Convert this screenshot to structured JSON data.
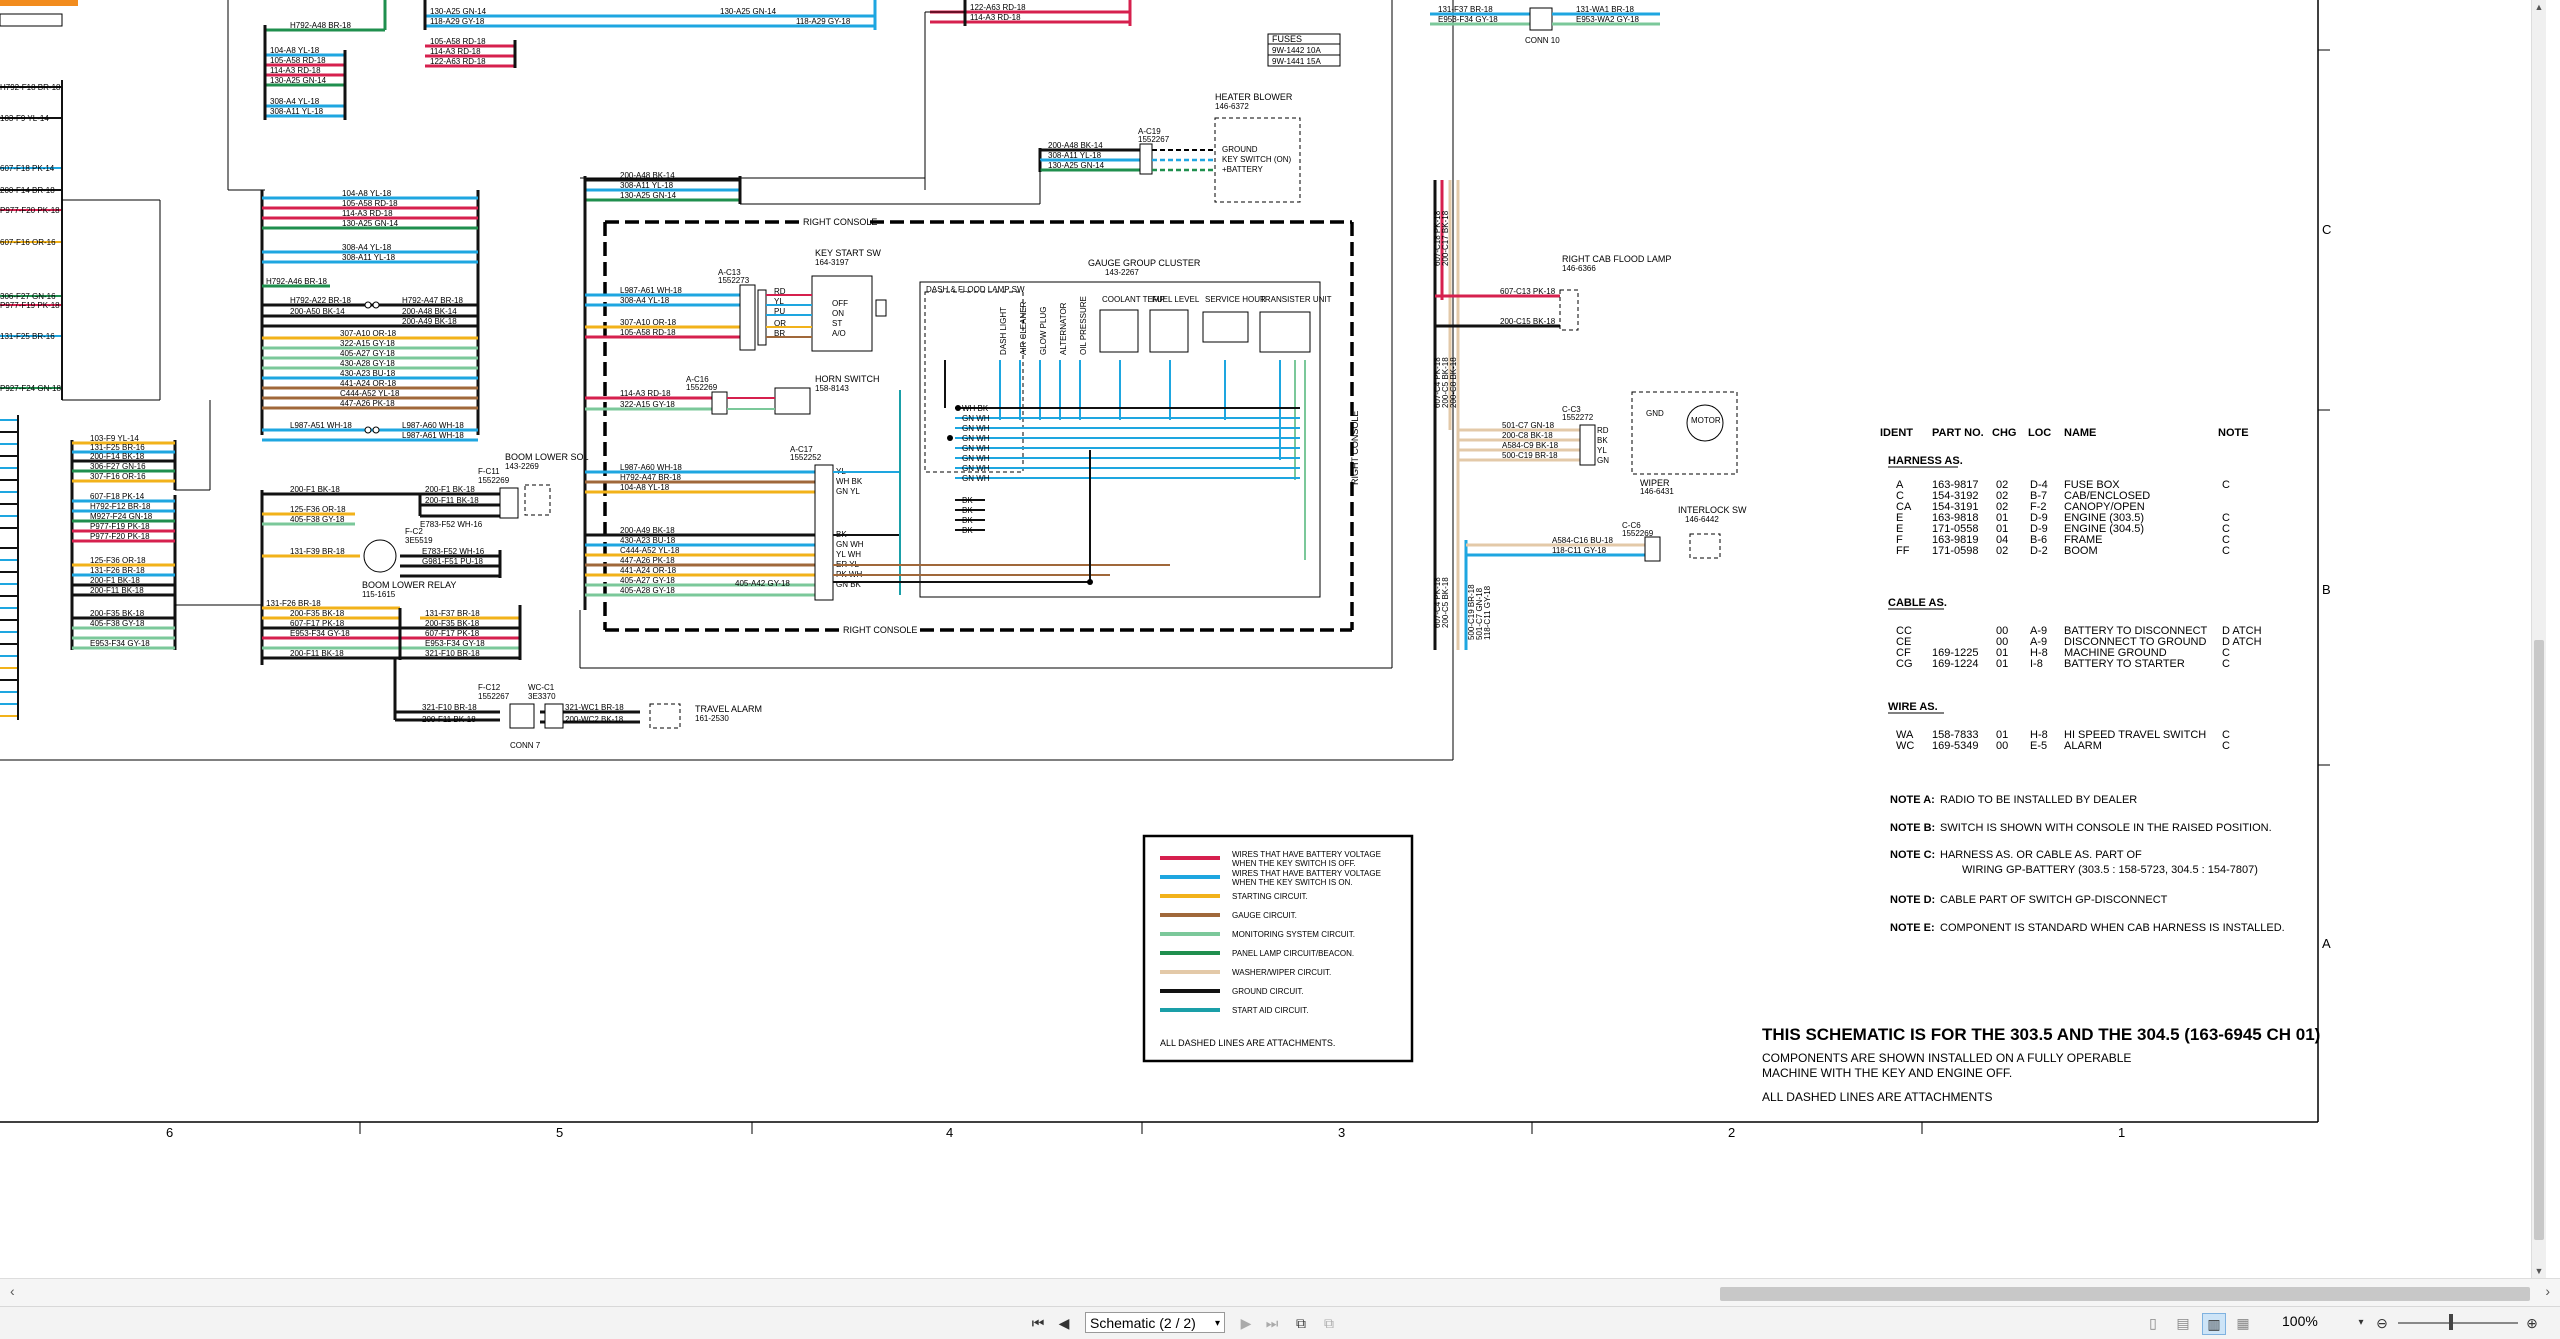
{
  "document": {
    "title": "THIS SCHEMATIC IS FOR THE 303.5 AND THE 304.5 (163-6945 CH 01)",
    "subtitle_lines": [
      "COMPONENTS ARE SHOWN INSTALLED ON A FULLY OPERABLE",
      "MACHINE WITH THE KEY AND ENGINE OFF.",
      "ALL DASHED LINES ARE ATTACHMENTS"
    ],
    "zones_bottom": [
      "6",
      "5",
      "4",
      "3",
      "2",
      "1"
    ],
    "zones_right": [
      "C",
      "B",
      "A"
    ]
  },
  "components": {
    "fuses": {
      "title": "FUSES",
      "rows": [
        "9W-1442  10A",
        "9W-1441  15A"
      ]
    },
    "heater_blower": {
      "name": "HEATER BLOWER",
      "part": "146-6372",
      "connector": "A-C19",
      "connector_part": "1552267",
      "pins": [
        "GROUND",
        "KEY SWITCH (ON)",
        "+BATTERY"
      ]
    },
    "right_console_top": "RIGHT CONSOLE",
    "right_console_bottom": "RIGHT CONSOLE",
    "right_console_side": "RIGHT CONSOLE",
    "key_start_sw": {
      "name": "KEY START SW",
      "part": "164-3197",
      "connector": "A-C13",
      "connector_part": "1552273",
      "pins": [
        "RD",
        "YL",
        "PU",
        "OR",
        "BR"
      ],
      "positions": [
        "OFF",
        "ON",
        "ST",
        "A/O"
      ]
    },
    "horn_switch": {
      "name": "HORN SWITCH",
      "part": "158-8143",
      "connector": "A-C16",
      "connector_part": "1552269"
    },
    "gauge_cluster": {
      "name": "GAUGE GROUP CLUSTER",
      "part": "143-2267",
      "connector": "A-C17",
      "connector_part": "1552252",
      "sections": [
        "DASH & FLOOD LAMP SW",
        "COOLANT TEMP",
        "FUEL LEVEL",
        "SERVICE HOUR",
        "TRANSISTER UNIT"
      ],
      "indicators": [
        "DASH LIGHT",
        "AIR CLEANER",
        "GLOW PLUG",
        "ALTERNATOR",
        "OIL PRESSURE"
      ]
    },
    "right_cab_flood_lamp": {
      "name": "RIGHT CAB FLOOD LAMP",
      "part": "146-6366"
    },
    "wiper": {
      "name": "WIPER",
      "part": "146-6431",
      "connector": "C-C3",
      "connector_part": "1552272",
      "pins": [
        "RD",
        "BK",
        "YL",
        "GN"
      ],
      "labels": [
        "GND",
        "MOTOR"
      ]
    },
    "interlock_sw": {
      "name": "INTERLOCK SW",
      "part": "146-6442",
      "connector": "C-C6",
      "connector_part": "1552269"
    },
    "boom_lower_sol": {
      "name": "BOOM LOWER SOL",
      "part": "143-2269",
      "connector": "F-C11",
      "connector_part": "1552269"
    },
    "boom_lower_relay": {
      "name": "BOOM LOWER RELAY",
      "part": "115-1615",
      "connector": "F-C2",
      "connector_part": "3E5519"
    },
    "travel_alarm": {
      "name": "TRAVEL ALARM",
      "part": "161-2530",
      "connector": "WC-C1",
      "connector_part": "3E3370",
      "connector2": "F-C12",
      "connector2_part": "1552267"
    },
    "conn7": "CONN 7",
    "conn10": "CONN 10"
  },
  "wire_labels": {
    "top_left": [
      "H792-A48  BR-18",
      "104-A8  YL-18",
      "105-A58  RD-18",
      "114-A3  RD-18",
      "130-A25  GN-14",
      "308-A4  YL-18",
      "308-A11  YL-18"
    ],
    "top_mid": [
      "130-A25  GN-14",
      "118-A29  GY-18",
      "105-A58  RD-18",
      "114-A3  RD-18",
      "122-A63  RD-18",
      "122-A63  RD-18",
      "114-A3  RD-18",
      "118-A29  GY-18"
    ],
    "bundle_mid": [
      "104-A8  YL-18",
      "105-A58  RD-18",
      "114-A3  RD-18",
      "130-A25  GN-14",
      "308-A4  YL-18",
      "308-A11  YL-18",
      "H792-A46  BR-18",
      "H792-A22  BR-18",
      "200-A50  BK-14",
      "307-A10  OR-18",
      "322-A15  GY-18",
      "405-A27  GY-18",
      "430-A28  GY-18",
      "430-A23  BU-18",
      "441-A24  OR-18",
      "C444-A52  YL-18",
      "447-A26  PK-18",
      "L987-A51  WH-18",
      "H792-A47  BR-18",
      "200-A48  BK-14",
      "200-A49  BK-18",
      "L987-A60  WH-18",
      "L987-A61  WH-18"
    ],
    "heater": [
      "200-A48  BK-14",
      "308-A11  YL-18",
      "130-A25  GN-14"
    ],
    "console_in": [
      "200-A48  BK-14",
      "308-A11  YL-18",
      "130-A25  GN-14",
      "L987-A61  WH-18",
      "308-A4  YL-18",
      "307-A10  OR-18",
      "105-A58  RD-18",
      "114-A3  RD-18",
      "322-A15  GY-18",
      "L987-A60  WH-18",
      "H792-A47  BR-18",
      "104-A8  YL-18",
      "200-A49  BK-18",
      "430-A23  BU-18",
      "C444-A52  YL-18",
      "447-A26  PK-18",
      "441-A24  OR-18",
      "405-A27  GY-18",
      "405-A28  GY-18",
      "405-A42  GY-18"
    ],
    "cluster_pins": [
      "YL",
      "WH BK",
      "GN YL",
      "BK",
      "GN WH",
      "YL WH",
      "ER YL",
      "PK WH",
      "GN BK"
    ],
    "cluster_inner": [
      "WH BK",
      "GN WH",
      "GN WH",
      "GN WH",
      "GN WH",
      "GN WH",
      "GN WH",
      "GN WH",
      "BK",
      "BK",
      "BK",
      "BK"
    ],
    "left_col": [
      "H792-F18  BR-18",
      "103-F9  YL-14",
      "607-F18  PK-14",
      "200-F14  BR-18",
      "P977-F20  PK-18",
      "607-F16  OR-16",
      "306-F27  GN-16",
      "P977-F19  PK-18",
      "131-F25  BR-16",
      "P927-F24  GN-18"
    ],
    "left_bundle": [
      "103-F9  YL-14",
      "131-F25  BR-16",
      "200-F14  BK-18",
      "306-F27  GN-16",
      "307-F16  OR-16",
      "607-F18  PK-14",
      "H792-F12  BR-18",
      "M927-F24  GN-18",
      "P977-F19  PK-18",
      "P977-F20  PK-18",
      "125-F36  OR-18",
      "131-F26  BR-18",
      "200-F1  BK-18",
      "200-F11  BK-18",
      "200-F35  BK-18",
      "405-F38  GY-18",
      "E953-F34  GY-18"
    ],
    "boom": [
      "200-F1  BK-18",
      "125-F36  OR-18",
      "405-F38  GY-18",
      "131-F39  BR-18",
      "131-F26  BR-18",
      "200-F35  BK-18",
      "607-F17  PK-18",
      "E953-F34  GY-18",
      "200-F11  BK-18",
      "200-F1  BK-18",
      "200-F11  BK-18",
      "E783-F52  WH-16",
      "E783-F52  WH-16",
      "G981-F51  PU-18",
      "131-F37  BR-18",
      "200-F35  BK-18",
      "607-F17  PK-18",
      "E953-F34  GY-18",
      "321-F10  BR-18",
      "321-F10  BR-18",
      "200-F11  BK-18",
      "321-WC1  BR-18",
      "200-WC2  BK-18"
    ],
    "right_cab": [
      "131-F37  BR-18",
      "E953-F34  GY-18",
      "131-WA1  BR-18",
      "E953-WA2  GY-18",
      "607-C13  PK-18",
      "200-C15  BK-18",
      "501-C7  GN-18",
      "200-C8  BK-18",
      "A584-C9  BK-18",
      "500-C19  BR-18",
      "A584-C16  BU-18",
      "118-C11  GY-18",
      "607-C18  PK-18",
      "200-C17  BK-18",
      "607-C4  PK-18",
      "200-C5  BK-18",
      "200-C8  BK-18",
      "607-C4  PK-18",
      "200-C5  BK-18",
      "500-C19  BR-18",
      "501-C7  GN-18",
      "118-C11  GY-18"
    ]
  },
  "parts_table": {
    "headers": [
      "IDENT",
      "PART NO.",
      "CHG",
      "LOC",
      "NAME",
      "NOTE"
    ],
    "harness_title": "HARNESS AS.",
    "harness_rows": [
      [
        "A",
        "163-9817",
        "02",
        "D-4",
        "FUSE BOX",
        "C"
      ],
      [
        "C",
        "154-3192",
        "02",
        "B-7",
        "CAB/ENCLOSED",
        ""
      ],
      [
        "CA",
        "154-3191",
        "02",
        "F-2",
        "CANOPY/OPEN",
        ""
      ],
      [
        "E",
        "163-9818",
        "01",
        "D-9",
        "ENGINE (303.5)",
        "C"
      ],
      [
        "E",
        "171-0558",
        "01",
        "D-9",
        "ENGINE (304.5)",
        "C"
      ],
      [
        "F",
        "163-9819",
        "04",
        "B-6",
        "FRAME",
        "C"
      ],
      [
        "FF",
        "171-0598",
        "02",
        "D-2",
        "BOOM",
        "C"
      ]
    ],
    "cable_title": "CABLE AS.",
    "cable_rows": [
      [
        "CC",
        "",
        "00",
        "A-9",
        "BATTERY TO DISCONNECT",
        "D  ATCH"
      ],
      [
        "CE",
        "",
        "00",
        "A-9",
        "DISCONNECT TO GROUND",
        "D  ATCH"
      ],
      [
        "CF",
        "169-1225",
        "01",
        "H-8",
        "MACHINE GROUND",
        "C"
      ],
      [
        "CG",
        "169-1224",
        "01",
        "I-8",
        "BATTERY TO STARTER",
        "C"
      ]
    ],
    "wire_title": "WIRE AS.",
    "wire_rows": [
      [
        "WA",
        "158-7833",
        "01",
        "H-8",
        "HI SPEED TRAVEL SWITCH",
        "C"
      ],
      [
        "WC",
        "169-5349",
        "00",
        "E-5",
        "ALARM",
        "C"
      ]
    ]
  },
  "notes": [
    {
      "key": "NOTE A:",
      "text": "RADIO TO BE INSTALLED BY DEALER"
    },
    {
      "key": "NOTE B:",
      "text": "SWITCH IS SHOWN WITH CONSOLE IN THE RAISED POSITION."
    },
    {
      "key": "NOTE C:",
      "text": "HARNESS AS. OR CABLE AS. PART OF"
    },
    {
      "key": "",
      "text": "WIRING GP-BATTERY (303.5 : 158-5723, 304.5 : 154-7807)"
    },
    {
      "key": "NOTE D:",
      "text": "CABLE PART OF SWITCH GP-DISCONNECT"
    },
    {
      "key": "NOTE E:",
      "text": "COMPONENT IS STANDARD WHEN CAB HARNESS IS INSTALLED."
    }
  ],
  "legend": {
    "items": [
      {
        "color": "#d6204e",
        "label1": "WIRES THAT HAVE BATTERY VOLTAGE",
        "label2": "WHEN THE KEY SWITCH IS OFF."
      },
      {
        "color": "#1ea6e0",
        "label1": "WIRES THAT HAVE BATTERY VOLTAGE",
        "label2": "WHEN THE KEY SWITCH IS ON."
      },
      {
        "color": "#f2b21a",
        "label1": "STARTING CIRCUIT.",
        "label2": ""
      },
      {
        "color": "#a0683a",
        "label1": "GAUGE CIRCUIT.",
        "label2": ""
      },
      {
        "color": "#7bc89a",
        "label1": "MONITORING SYSTEM CIRCUIT.",
        "label2": ""
      },
      {
        "color": "#1f8f4e",
        "label1": "PANEL LAMP CIRCUIT/BEACON.",
        "label2": ""
      },
      {
        "color": "#e3c9a8",
        "label1": "WASHER/WIPER CIRCUIT.",
        "label2": ""
      },
      {
        "color": "#111111",
        "label1": "GROUND CIRCUIT.",
        "label2": ""
      },
      {
        "color": "#1a9fa8",
        "label1": "START AID CIRCUIT.",
        "label2": ""
      }
    ],
    "footer": "ALL DASHED LINES ARE ATTACHMENTS."
  },
  "viewer": {
    "page_label": "Schematic (2 / 2)",
    "zoom": "100%",
    "first_page_icon": "first-page-icon",
    "prev_page_icon": "prev-page-icon",
    "next_page_icon": "next-page-icon",
    "last_page_icon": "last-page-icon"
  }
}
